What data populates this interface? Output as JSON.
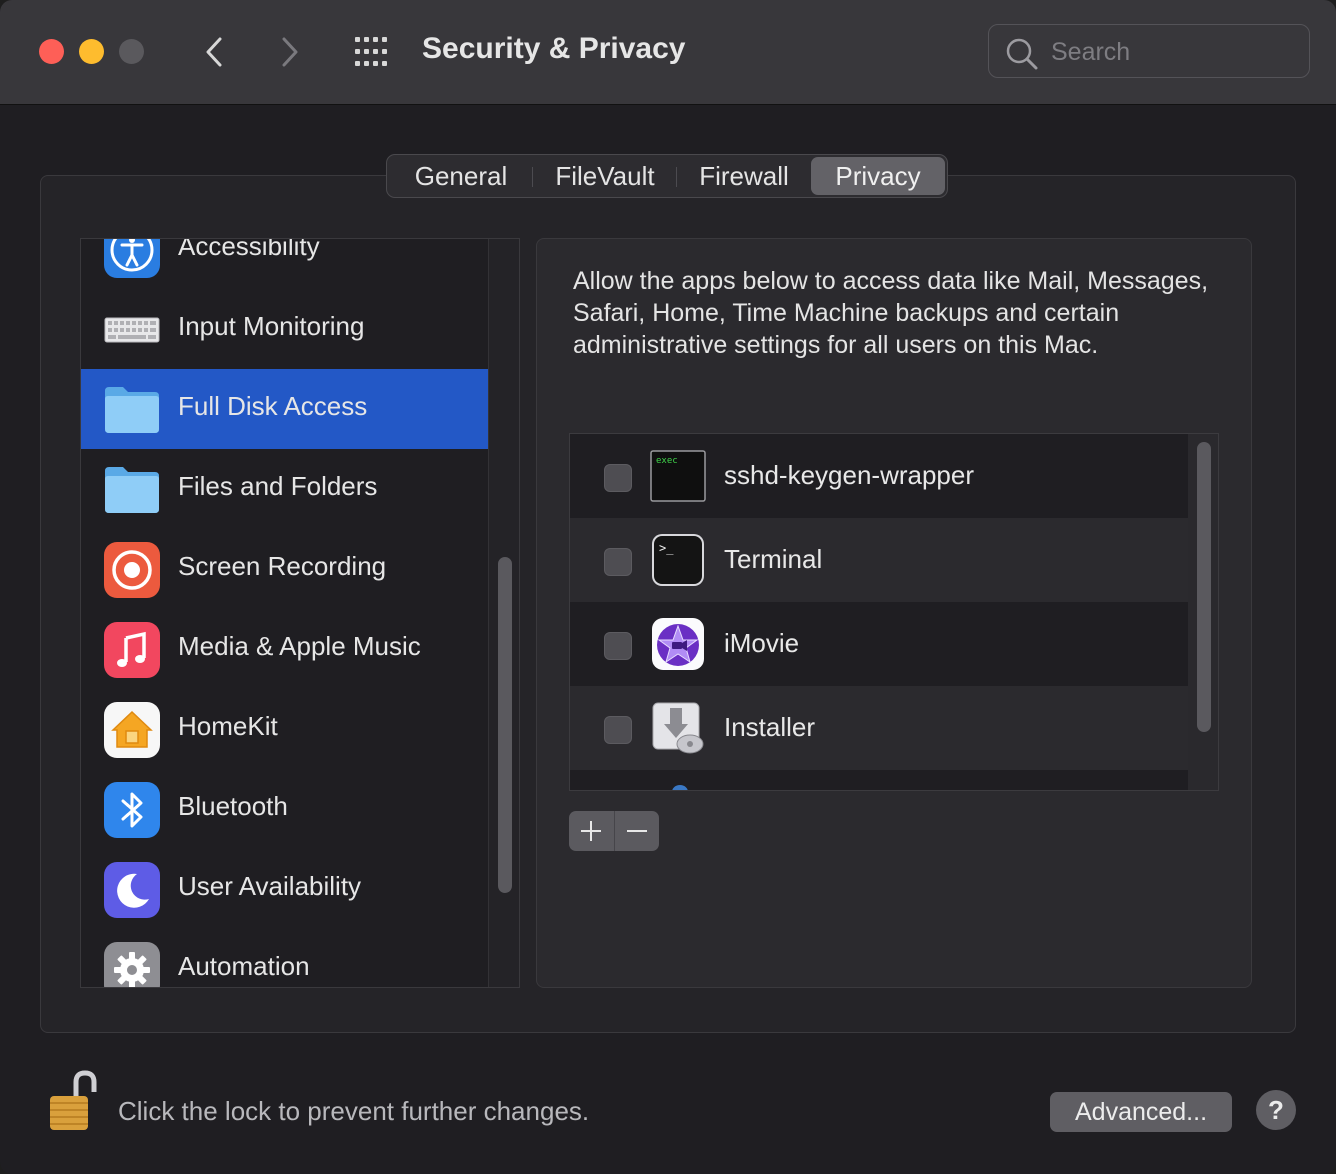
{
  "window": {
    "title": "Security & Privacy",
    "search_placeholder": "Search"
  },
  "tabs": [
    {
      "label": "General",
      "active": false
    },
    {
      "label": "FileVault",
      "active": false
    },
    {
      "label": "Firewall",
      "active": false
    },
    {
      "label": "Privacy",
      "active": true
    }
  ],
  "sidebar": {
    "selected": "Full Disk Access",
    "items": [
      {
        "label": "Accessibility",
        "icon": "accessibility-icon"
      },
      {
        "label": "Input Monitoring",
        "icon": "keyboard-icon"
      },
      {
        "label": "Full Disk Access",
        "icon": "folder-icon"
      },
      {
        "label": "Files and Folders",
        "icon": "folder-icon"
      },
      {
        "label": "Screen Recording",
        "icon": "screen-recording-icon"
      },
      {
        "label": "Media & Apple Music",
        "icon": "music-icon"
      },
      {
        "label": "HomeKit",
        "icon": "home-icon"
      },
      {
        "label": "Bluetooth",
        "icon": "bluetooth-icon"
      },
      {
        "label": "User Availability",
        "icon": "moon-icon"
      },
      {
        "label": "Automation",
        "icon": "gear-icon"
      }
    ]
  },
  "content": {
    "description": "Allow the apps below to access data like Mail, Messages, Safari, Home, Time Machine backups and certain administrative settings for all users on this Mac.",
    "apps": [
      {
        "label": "sshd-keygen-wrapper",
        "icon": "exec-icon",
        "checked": false,
        "icon_text": "exec"
      },
      {
        "label": "Terminal",
        "icon": "terminal-icon",
        "checked": false,
        "icon_text": ">_"
      },
      {
        "label": "iMovie",
        "icon": "imovie-icon",
        "checked": false
      },
      {
        "label": "Installer",
        "icon": "installer-icon",
        "checked": false
      }
    ],
    "add_label": "+",
    "remove_label": "−"
  },
  "footer": {
    "lock_text": "Click the lock to prevent further changes.",
    "advanced_label": "Advanced...",
    "help_label": "?"
  },
  "colors": {
    "selection": "#2358c6",
    "close": "#fe5f57",
    "minimize": "#febc2e"
  }
}
